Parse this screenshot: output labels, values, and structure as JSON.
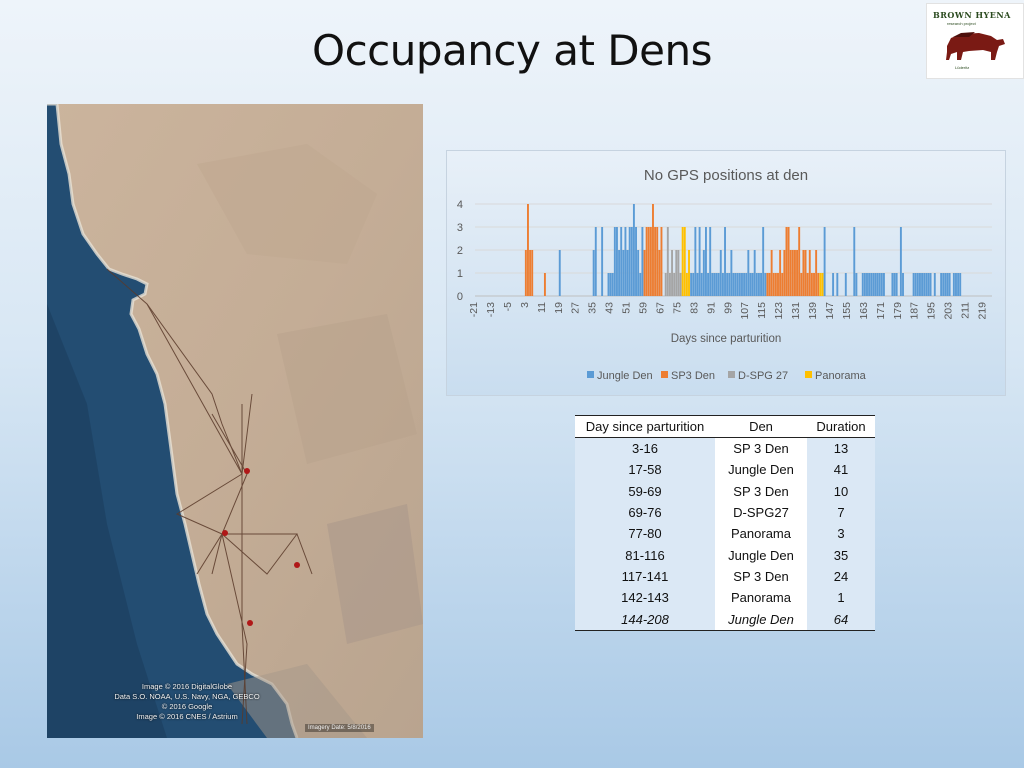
{
  "slide": {
    "title": "Occupancy at Dens"
  },
  "logo": {
    "title": "BROWN HYENA",
    "subtitle": "research project",
    "footer": "Lüderitz",
    "icon": "hyena-icon"
  },
  "map": {
    "credits": [
      "Image © 2016 DigitalGlobe",
      "Data S.O. NOAA, U.S. Navy, NGA, GEBCO",
      "© 2016 Google",
      "Image © 2016 CNES / Astrium"
    ],
    "scale_text": "Imagery Date: 5/8/2016",
    "colors": {
      "ocean": "#1f4a6e",
      "land": "#c9b29a",
      "track": "#5a3a2a",
      "point": "#b01818"
    }
  },
  "chart_data": {
    "type": "bar",
    "title": "No GPS positions at den",
    "xlabel": "Days since parturition",
    "ylabel": "",
    "ylim": [
      0,
      4
    ],
    "yticks": [
      0,
      1,
      2,
      3,
      4
    ],
    "x_tick_labels": [
      "-21",
      "-13",
      "-5",
      "3",
      "11",
      "19",
      "27",
      "35",
      "43",
      "51",
      "59",
      "67",
      "75",
      "83",
      "91",
      "99",
      "107",
      "115",
      "123",
      "131",
      "139",
      "147",
      "155",
      "163",
      "171",
      "179",
      "187",
      "195",
      "203",
      "211",
      "219"
    ],
    "x_range": [
      -21,
      223
    ],
    "legend_position": "bottom",
    "series": [
      {
        "name": "Jungle Den",
        "color": "#5b9bd5",
        "points": [
          [
            19,
            2
          ],
          [
            35,
            2
          ],
          [
            36,
            3
          ],
          [
            39,
            3
          ],
          [
            42,
            1
          ],
          [
            43,
            1
          ],
          [
            44,
            1
          ],
          [
            45,
            3
          ],
          [
            46,
            3
          ],
          [
            47,
            2
          ],
          [
            48,
            3
          ],
          [
            49,
            2
          ],
          [
            50,
            3
          ],
          [
            51,
            2
          ],
          [
            52,
            3
          ],
          [
            53,
            3
          ],
          [
            54,
            4
          ],
          [
            55,
            3
          ],
          [
            56,
            2
          ],
          [
            57,
            1
          ],
          [
            58,
            3
          ],
          [
            81,
            1
          ],
          [
            82,
            1
          ],
          [
            83,
            3
          ],
          [
            84,
            1
          ],
          [
            85,
            3
          ],
          [
            86,
            1
          ],
          [
            87,
            2
          ],
          [
            88,
            3
          ],
          [
            89,
            1
          ],
          [
            90,
            3
          ],
          [
            91,
            1
          ],
          [
            92,
            1
          ],
          [
            93,
            1
          ],
          [
            94,
            1
          ],
          [
            95,
            2
          ],
          [
            96,
            1
          ],
          [
            97,
            3
          ],
          [
            98,
            1
          ],
          [
            99,
            1
          ],
          [
            100,
            2
          ],
          [
            101,
            1
          ],
          [
            102,
            1
          ],
          [
            103,
            1
          ],
          [
            104,
            1
          ],
          [
            105,
            1
          ],
          [
            106,
            1
          ],
          [
            107,
            1
          ],
          [
            108,
            2
          ],
          [
            109,
            1
          ],
          [
            110,
            1
          ],
          [
            111,
            2
          ],
          [
            112,
            1
          ],
          [
            113,
            1
          ],
          [
            114,
            1
          ],
          [
            115,
            3
          ],
          [
            116,
            1
          ],
          [
            144,
            3
          ],
          [
            148,
            1
          ],
          [
            150,
            1
          ],
          [
            154,
            1
          ],
          [
            158,
            3
          ],
          [
            159,
            1
          ],
          [
            162,
            1
          ],
          [
            163,
            1
          ],
          [
            164,
            1
          ],
          [
            165,
            1
          ],
          [
            166,
            1
          ],
          [
            167,
            1
          ],
          [
            168,
            1
          ],
          [
            169,
            1
          ],
          [
            170,
            1
          ],
          [
            171,
            1
          ],
          [
            172,
            1
          ],
          [
            176,
            1
          ],
          [
            177,
            1
          ],
          [
            178,
            1
          ],
          [
            180,
            3
          ],
          [
            181,
            1
          ],
          [
            186,
            1
          ],
          [
            187,
            1
          ],
          [
            188,
            1
          ],
          [
            189,
            1
          ],
          [
            190,
            1
          ],
          [
            191,
            1
          ],
          [
            192,
            1
          ],
          [
            193,
            1
          ],
          [
            194,
            1
          ],
          [
            196,
            1
          ],
          [
            199,
            1
          ],
          [
            200,
            1
          ],
          [
            201,
            1
          ],
          [
            202,
            1
          ],
          [
            203,
            1
          ],
          [
            205,
            1
          ],
          [
            206,
            1
          ],
          [
            207,
            1
          ],
          [
            208,
            1
          ]
        ]
      },
      {
        "name": "SP3 Den",
        "color": "#ed7d31",
        "points": [
          [
            3,
            2
          ],
          [
            4,
            4
          ],
          [
            5,
            2
          ],
          [
            6,
            2
          ],
          [
            12,
            1
          ],
          [
            59,
            2
          ],
          [
            60,
            3
          ],
          [
            61,
            3
          ],
          [
            62,
            3
          ],
          [
            63,
            4
          ],
          [
            64,
            3
          ],
          [
            65,
            3
          ],
          [
            66,
            2
          ],
          [
            67,
            3
          ],
          [
            117,
            1
          ],
          [
            118,
            1
          ],
          [
            119,
            2
          ],
          [
            120,
            1
          ],
          [
            121,
            1
          ],
          [
            122,
            1
          ],
          [
            123,
            2
          ],
          [
            124,
            1
          ],
          [
            125,
            2
          ],
          [
            126,
            3
          ],
          [
            127,
            3
          ],
          [
            128,
            2
          ],
          [
            129,
            2
          ],
          [
            130,
            2
          ],
          [
            131,
            2
          ],
          [
            132,
            3
          ],
          [
            133,
            1
          ],
          [
            134,
            2
          ],
          [
            135,
            2
          ],
          [
            136,
            1
          ],
          [
            137,
            2
          ],
          [
            138,
            1
          ],
          [
            139,
            1
          ],
          [
            140,
            2
          ],
          [
            141,
            1
          ]
        ]
      },
      {
        "name": "D-SPG 27",
        "color": "#a5a5a5",
        "points": [
          [
            69,
            1
          ],
          [
            70,
            3
          ],
          [
            71,
            1
          ],
          [
            72,
            2
          ],
          [
            73,
            1
          ],
          [
            74,
            2
          ],
          [
            75,
            2
          ],
          [
            76,
            1
          ]
        ]
      },
      {
        "name": "Panorama",
        "color": "#ffc000",
        "points": [
          [
            77,
            3
          ],
          [
            78,
            3
          ],
          [
            79,
            1
          ],
          [
            80,
            2
          ],
          [
            142,
            1
          ],
          [
            143,
            1
          ]
        ]
      }
    ]
  },
  "table": {
    "headers": [
      "Day since parturition",
      "Den",
      "Duration"
    ],
    "rows": [
      [
        "3-16",
        "SP 3 Den",
        "13"
      ],
      [
        "17-58",
        "Jungle Den",
        "41"
      ],
      [
        "59-69",
        "SP 3 Den",
        "10"
      ],
      [
        "69-76",
        "D-SPG27",
        "7"
      ],
      [
        "77-80",
        "Panorama",
        "3"
      ],
      [
        "81-116",
        "Jungle Den",
        "35"
      ],
      [
        "117-141",
        "SP 3 Den",
        "24"
      ],
      [
        "142-143",
        "Panorama",
        "1"
      ],
      [
        "144-208",
        "Jungle Den",
        "64"
      ]
    ]
  }
}
